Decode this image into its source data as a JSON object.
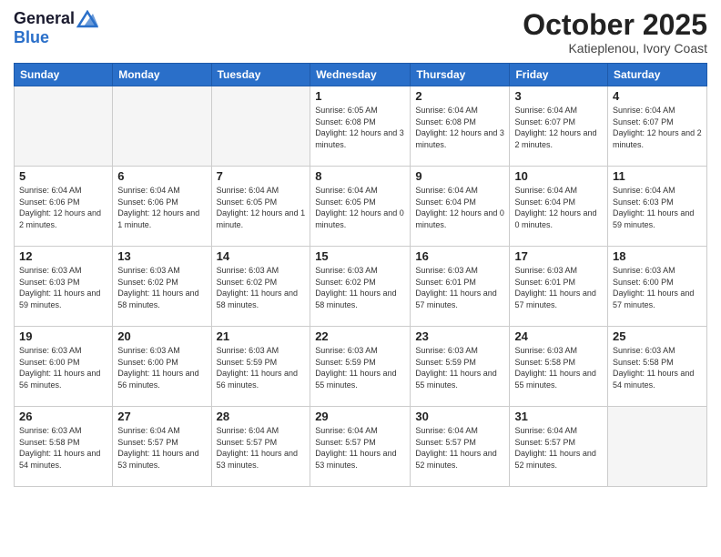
{
  "header": {
    "logo_line1": "General",
    "logo_line2": "Blue",
    "month": "October 2025",
    "location": "Katieplenou, Ivory Coast"
  },
  "days_of_week": [
    "Sunday",
    "Monday",
    "Tuesday",
    "Wednesday",
    "Thursday",
    "Friday",
    "Saturday"
  ],
  "weeks": [
    [
      {
        "day": "",
        "info": ""
      },
      {
        "day": "",
        "info": ""
      },
      {
        "day": "",
        "info": ""
      },
      {
        "day": "1",
        "info": "Sunrise: 6:05 AM\nSunset: 6:08 PM\nDaylight: 12 hours and 3 minutes."
      },
      {
        "day": "2",
        "info": "Sunrise: 6:04 AM\nSunset: 6:08 PM\nDaylight: 12 hours and 3 minutes."
      },
      {
        "day": "3",
        "info": "Sunrise: 6:04 AM\nSunset: 6:07 PM\nDaylight: 12 hours and 2 minutes."
      },
      {
        "day": "4",
        "info": "Sunrise: 6:04 AM\nSunset: 6:07 PM\nDaylight: 12 hours and 2 minutes."
      }
    ],
    [
      {
        "day": "5",
        "info": "Sunrise: 6:04 AM\nSunset: 6:06 PM\nDaylight: 12 hours and 2 minutes."
      },
      {
        "day": "6",
        "info": "Sunrise: 6:04 AM\nSunset: 6:06 PM\nDaylight: 12 hours and 1 minute."
      },
      {
        "day": "7",
        "info": "Sunrise: 6:04 AM\nSunset: 6:05 PM\nDaylight: 12 hours and 1 minute."
      },
      {
        "day": "8",
        "info": "Sunrise: 6:04 AM\nSunset: 6:05 PM\nDaylight: 12 hours and 0 minutes."
      },
      {
        "day": "9",
        "info": "Sunrise: 6:04 AM\nSunset: 6:04 PM\nDaylight: 12 hours and 0 minutes."
      },
      {
        "day": "10",
        "info": "Sunrise: 6:04 AM\nSunset: 6:04 PM\nDaylight: 12 hours and 0 minutes."
      },
      {
        "day": "11",
        "info": "Sunrise: 6:04 AM\nSunset: 6:03 PM\nDaylight: 11 hours and 59 minutes."
      }
    ],
    [
      {
        "day": "12",
        "info": "Sunrise: 6:03 AM\nSunset: 6:03 PM\nDaylight: 11 hours and 59 minutes."
      },
      {
        "day": "13",
        "info": "Sunrise: 6:03 AM\nSunset: 6:02 PM\nDaylight: 11 hours and 58 minutes."
      },
      {
        "day": "14",
        "info": "Sunrise: 6:03 AM\nSunset: 6:02 PM\nDaylight: 11 hours and 58 minutes."
      },
      {
        "day": "15",
        "info": "Sunrise: 6:03 AM\nSunset: 6:02 PM\nDaylight: 11 hours and 58 minutes."
      },
      {
        "day": "16",
        "info": "Sunrise: 6:03 AM\nSunset: 6:01 PM\nDaylight: 11 hours and 57 minutes."
      },
      {
        "day": "17",
        "info": "Sunrise: 6:03 AM\nSunset: 6:01 PM\nDaylight: 11 hours and 57 minutes."
      },
      {
        "day": "18",
        "info": "Sunrise: 6:03 AM\nSunset: 6:00 PM\nDaylight: 11 hours and 57 minutes."
      }
    ],
    [
      {
        "day": "19",
        "info": "Sunrise: 6:03 AM\nSunset: 6:00 PM\nDaylight: 11 hours and 56 minutes."
      },
      {
        "day": "20",
        "info": "Sunrise: 6:03 AM\nSunset: 6:00 PM\nDaylight: 11 hours and 56 minutes."
      },
      {
        "day": "21",
        "info": "Sunrise: 6:03 AM\nSunset: 5:59 PM\nDaylight: 11 hours and 56 minutes."
      },
      {
        "day": "22",
        "info": "Sunrise: 6:03 AM\nSunset: 5:59 PM\nDaylight: 11 hours and 55 minutes."
      },
      {
        "day": "23",
        "info": "Sunrise: 6:03 AM\nSunset: 5:59 PM\nDaylight: 11 hours and 55 minutes."
      },
      {
        "day": "24",
        "info": "Sunrise: 6:03 AM\nSunset: 5:58 PM\nDaylight: 11 hours and 55 minutes."
      },
      {
        "day": "25",
        "info": "Sunrise: 6:03 AM\nSunset: 5:58 PM\nDaylight: 11 hours and 54 minutes."
      }
    ],
    [
      {
        "day": "26",
        "info": "Sunrise: 6:03 AM\nSunset: 5:58 PM\nDaylight: 11 hours and 54 minutes."
      },
      {
        "day": "27",
        "info": "Sunrise: 6:04 AM\nSunset: 5:57 PM\nDaylight: 11 hours and 53 minutes."
      },
      {
        "day": "28",
        "info": "Sunrise: 6:04 AM\nSunset: 5:57 PM\nDaylight: 11 hours and 53 minutes."
      },
      {
        "day": "29",
        "info": "Sunrise: 6:04 AM\nSunset: 5:57 PM\nDaylight: 11 hours and 53 minutes."
      },
      {
        "day": "30",
        "info": "Sunrise: 6:04 AM\nSunset: 5:57 PM\nDaylight: 11 hours and 52 minutes."
      },
      {
        "day": "31",
        "info": "Sunrise: 6:04 AM\nSunset: 5:57 PM\nDaylight: 11 hours and 52 minutes."
      },
      {
        "day": "",
        "info": ""
      }
    ]
  ]
}
